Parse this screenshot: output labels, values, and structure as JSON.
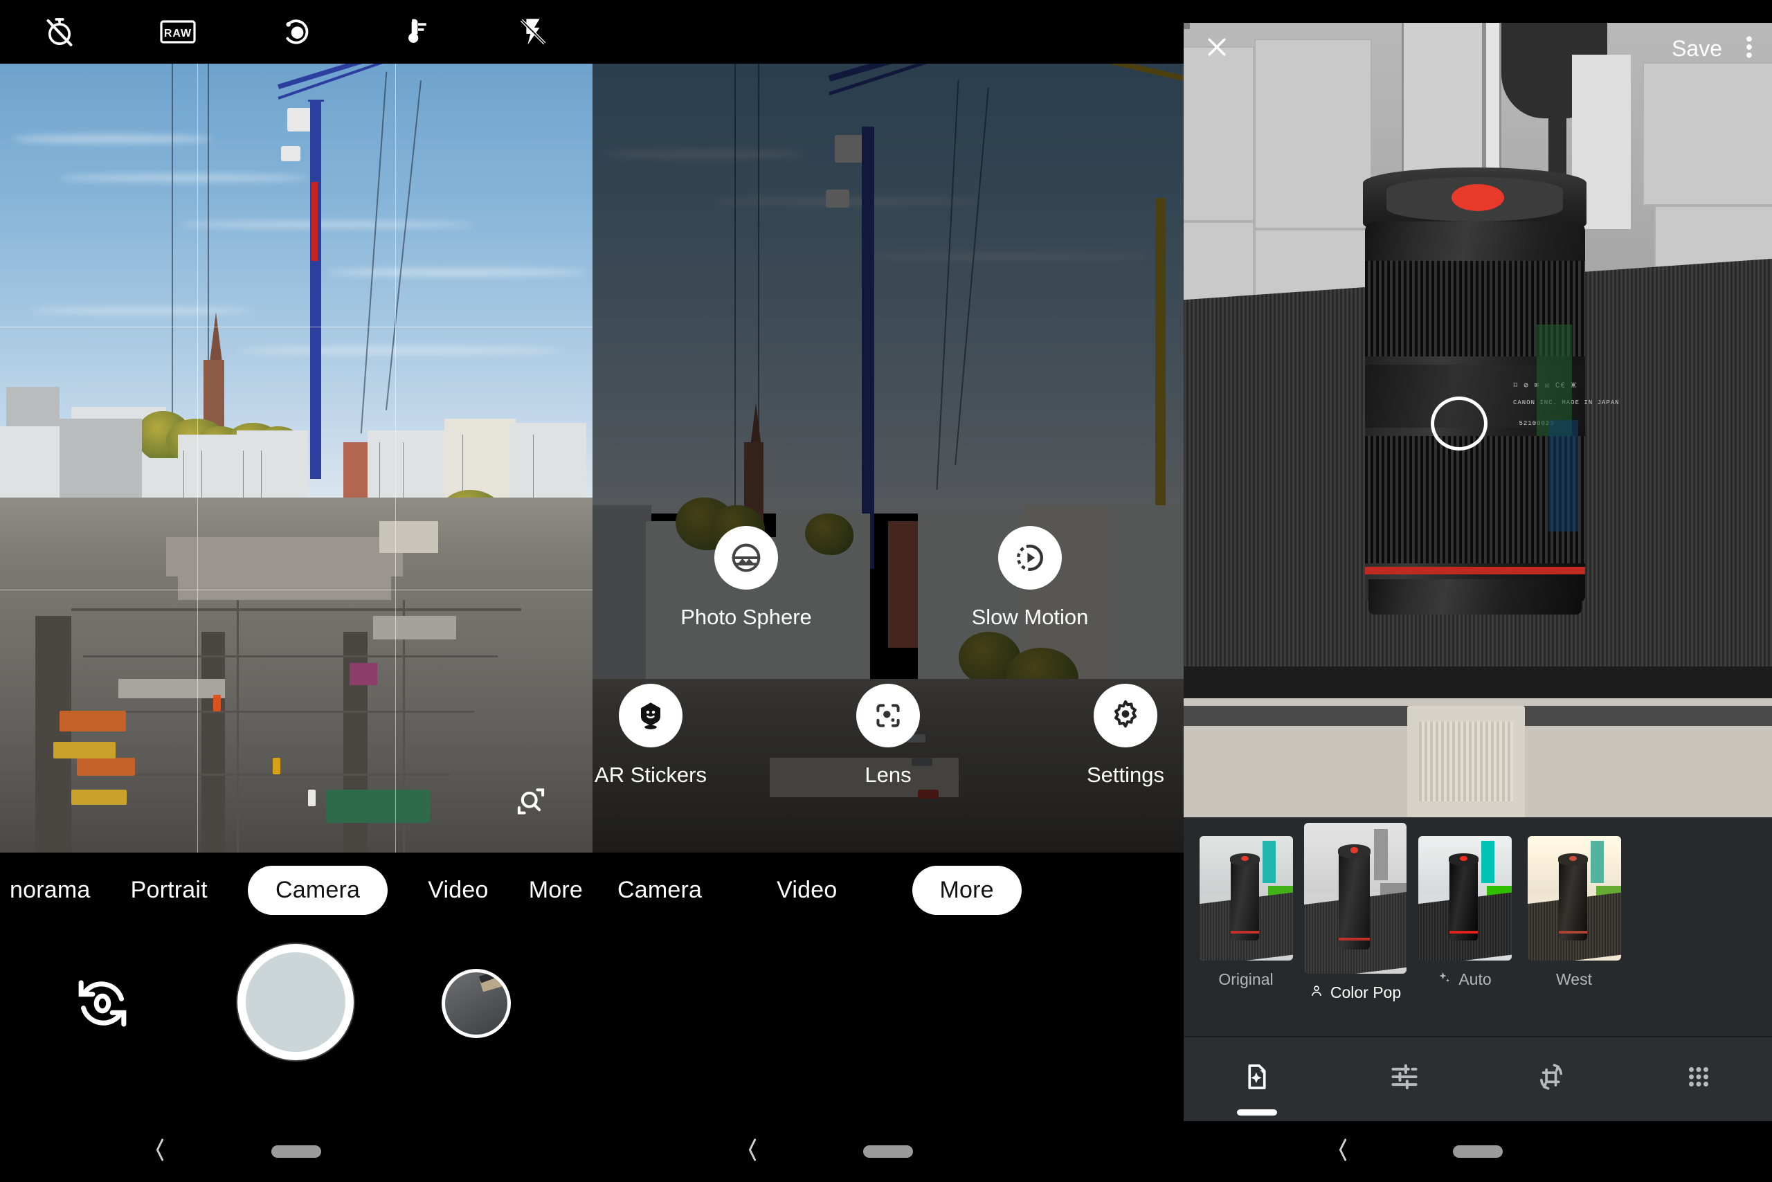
{
  "camera_panel": {
    "topbar": [
      {
        "name": "timer-off-icon",
        "label": "Timer off"
      },
      {
        "name": "raw-icon",
        "label": "RAW"
      },
      {
        "name": "motion-photo-icon",
        "label": "Motion"
      },
      {
        "name": "white-balance-icon",
        "label": "White balance"
      },
      {
        "name": "flash-off-icon",
        "label": "Flash off"
      }
    ],
    "viewfinder": {
      "zoom_icon": "magnify-icon",
      "grid": "rule-of-thirds"
    },
    "modes": [
      {
        "label": "norama",
        "selected": false
      },
      {
        "label": "Portrait",
        "selected": false
      },
      {
        "label": "Camera",
        "selected": true
      },
      {
        "label": "Video",
        "selected": false
      },
      {
        "label": "More",
        "selected": false
      }
    ],
    "capture": {
      "flip_label": "Switch camera",
      "shutter_label": "Shutter",
      "thumb_label": "Last photo"
    },
    "nav": {
      "back": "Back",
      "home": "Home"
    }
  },
  "more_panel": {
    "modes": [
      {
        "label": "Camera",
        "selected": false
      },
      {
        "label": "Video",
        "selected": false
      },
      {
        "label": "More",
        "selected": true
      }
    ],
    "items": [
      {
        "label": "Photo Sphere",
        "icon": "photo-sphere-icon"
      },
      {
        "label": "Slow Motion",
        "icon": "slow-motion-icon"
      },
      {
        "label": "AR Stickers",
        "icon": "ar-stickers-icon"
      },
      {
        "label": "Lens",
        "icon": "lens-icon"
      },
      {
        "label": "Settings",
        "icon": "settings-gear-icon"
      }
    ],
    "nav": {
      "back": "Back",
      "home": "Home"
    }
  },
  "editor_panel": {
    "header": {
      "close_icon": "close-icon",
      "save_label": "Save",
      "overflow_icon": "more-vert-icon"
    },
    "selection_handle": "color-pop-selection-handle",
    "filters": [
      {
        "label": "Original",
        "selected": false,
        "icon": null,
        "gray": false
      },
      {
        "label": "Color Pop",
        "selected": true,
        "icon": "person-icon",
        "gray": false
      },
      {
        "label": "Auto",
        "selected": false,
        "icon": "sparkle-icon",
        "gray": false
      },
      {
        "label": "West",
        "selected": false,
        "icon": null,
        "gray": false
      }
    ],
    "tools": [
      {
        "name": "filters-tool",
        "icon": "auto-enhance-icon",
        "selected": true
      },
      {
        "name": "adjust-tool",
        "icon": "sliders-icon",
        "selected": false
      },
      {
        "name": "crop-rotate-tool",
        "icon": "crop-rotate-icon",
        "selected": false
      },
      {
        "name": "markup-tool",
        "icon": "grid-dots-icon",
        "selected": false
      }
    ],
    "nav": {
      "back": "Back",
      "home": "Home"
    }
  },
  "colors": {
    "accent_white": "#ffffff",
    "panel_bg": "#000000",
    "editor_bg": "#272a2c",
    "toolbar_bg": "#2c2f31",
    "lens_red": "#e8392b",
    "crane_blue": "#2d3f9e"
  }
}
